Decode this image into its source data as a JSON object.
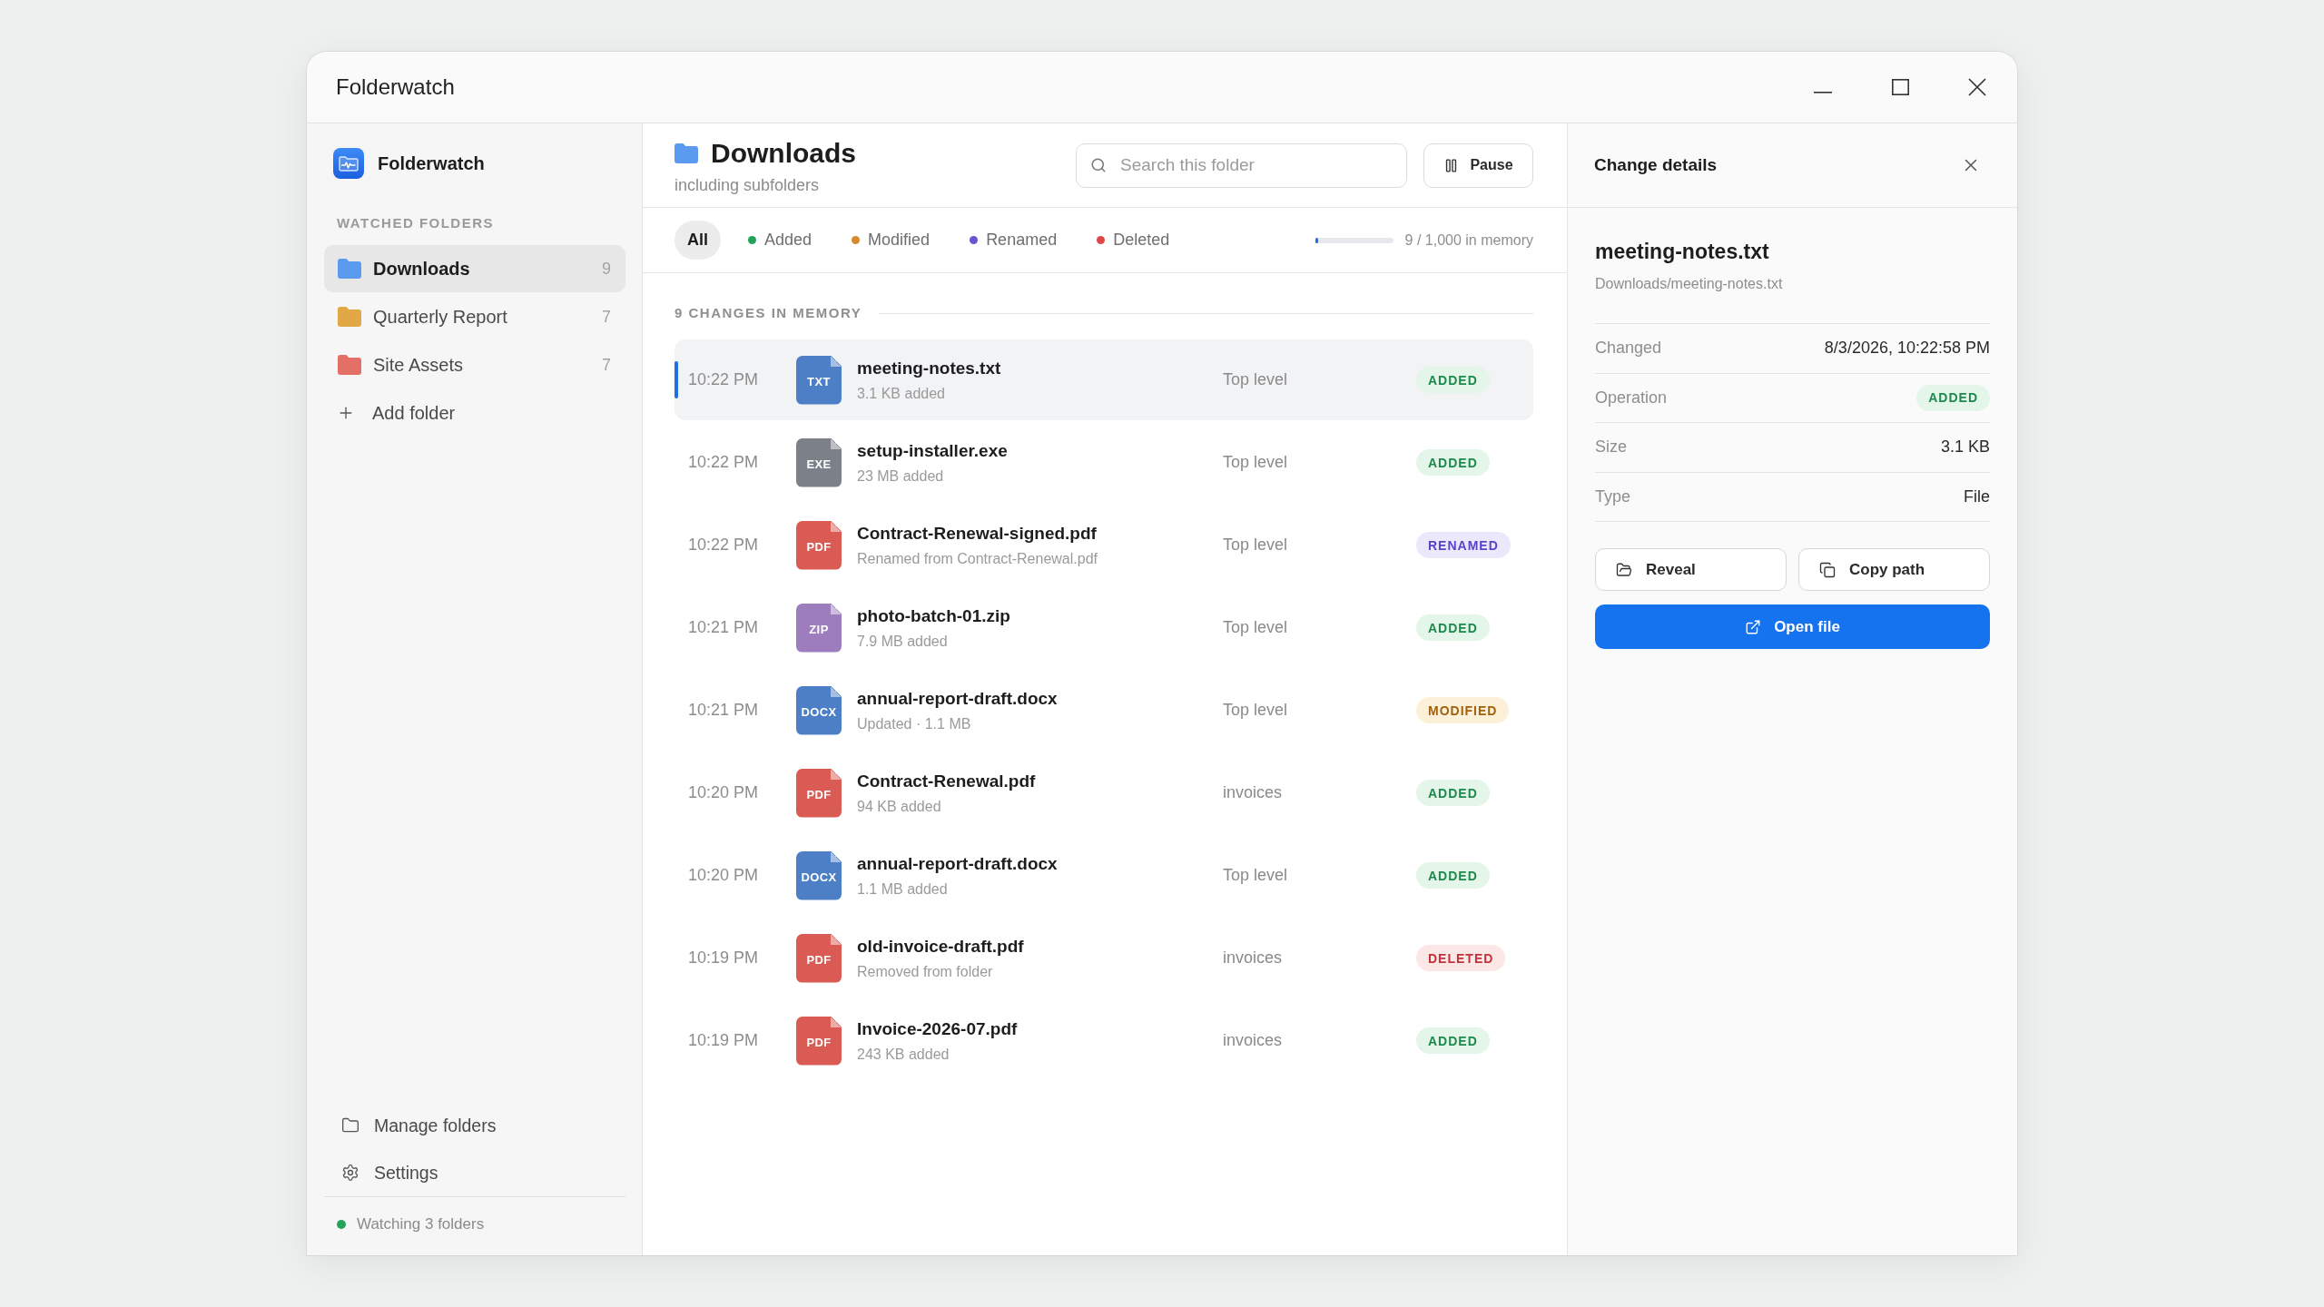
{
  "window": {
    "title": "Folderwatch"
  },
  "sidebar": {
    "brand": "Folderwatch",
    "heading": "WATCHED FOLDERS",
    "folders": [
      {
        "name": "Downloads",
        "count": "9",
        "color": "#5b9bef",
        "selected": true
      },
      {
        "name": "Quarterly Report",
        "count": "7",
        "color": "#e2a846",
        "selected": false
      },
      {
        "name": "Site Assets",
        "count": "7",
        "color": "#e46f66",
        "selected": false
      }
    ],
    "add_folder": "Add folder",
    "links": [
      "Manage folders",
      "Settings"
    ],
    "status": {
      "text": "Watching 3 folders",
      "color": "#22a35a"
    }
  },
  "header": {
    "title": "Downloads",
    "subtitle": "including subfolders",
    "search": {
      "placeholder": "Search this folder"
    },
    "pause_button": "Pause"
  },
  "filters": [
    {
      "label": "All",
      "selected": true
    },
    {
      "label": "Added",
      "color": "#22a35a",
      "selected": false
    },
    {
      "label": "Modified",
      "color": "#d8892c",
      "selected": false
    },
    {
      "label": "Renamed",
      "color": "#6a52d3",
      "selected": false
    },
    {
      "label": "Deleted",
      "color": "#e04848",
      "selected": false
    }
  ],
  "memory": {
    "level": 0.009,
    "label": "9 / 1,000 in memory"
  },
  "changes": {
    "heading": "9 CHANGES IN MEMORY",
    "rows": [
      {
        "time": "10:22 PM",
        "ext": "TXT",
        "color": "#4d7fc6",
        "name": "meeting-notes.txt",
        "detail": "3.1 KB added",
        "location": "Top level",
        "status": "ADDED",
        "kind": "added",
        "selected": true
      },
      {
        "time": "10:22 PM",
        "ext": "EXE",
        "color": "#7b8089",
        "name": "setup-installer.exe",
        "detail": "23 MB added",
        "location": "Top level",
        "status": "ADDED",
        "kind": "added",
        "selected": false
      },
      {
        "time": "10:22 PM",
        "ext": "PDF",
        "color": "#d95b53",
        "name": "Contract-Renewal-signed.pdf",
        "detail": "Renamed from Contract-Renewal.pdf",
        "location": "Top level",
        "status": "RENAMED",
        "kind": "renamed",
        "selected": false
      },
      {
        "time": "10:21 PM",
        "ext": "ZIP",
        "color": "#9d7dbd",
        "name": "photo-batch-01.zip",
        "detail": "7.9 MB added",
        "location": "Top level",
        "status": "ADDED",
        "kind": "added",
        "selected": false
      },
      {
        "time": "10:21 PM",
        "ext": "DOCX",
        "color": "#4d7fc6",
        "name": "annual-report-draft.docx",
        "detail": "Updated · 1.1 MB",
        "location": "Top level",
        "status": "MODIFIED",
        "kind": "modified",
        "selected": false
      },
      {
        "time": "10:20 PM",
        "ext": "PDF",
        "color": "#d95b53",
        "name": "Contract-Renewal.pdf",
        "detail": "94 KB added",
        "location": "invoices",
        "status": "ADDED",
        "kind": "added",
        "selected": false
      },
      {
        "time": "10:20 PM",
        "ext": "DOCX",
        "color": "#4d7fc6",
        "name": "annual-report-draft.docx",
        "detail": "1.1 MB added",
        "location": "Top level",
        "status": "ADDED",
        "kind": "added",
        "selected": false
      },
      {
        "time": "10:19 PM",
        "ext": "PDF",
        "color": "#d95b53",
        "name": "old-invoice-draft.pdf",
        "detail": "Removed from folder",
        "location": "invoices",
        "status": "DELETED",
        "kind": "deleted",
        "selected": false
      },
      {
        "time": "10:19 PM",
        "ext": "PDF",
        "color": "#d95b53",
        "name": "Invoice-2026-07.pdf",
        "detail": "243 KB added",
        "location": "invoices",
        "status": "ADDED",
        "kind": "added",
        "selected": false
      }
    ]
  },
  "details": {
    "title": "Change details",
    "file_name": "meeting-notes.txt",
    "path": "Downloads/meeting-notes.txt",
    "fields": [
      {
        "label": "Changed",
        "kind": "text",
        "value": "8/3/2026, 10:22:58 PM"
      },
      {
        "label": "Operation",
        "kind": "badge",
        "badge": {
          "text": "ADDED",
          "kind": "added"
        }
      },
      {
        "label": "Size",
        "kind": "text",
        "value": "3.1 KB"
      },
      {
        "label": "Type",
        "kind": "text",
        "value": "File"
      }
    ],
    "actions": [
      {
        "label": "Reveal",
        "kind": "secondary"
      },
      {
        "label": "Copy path",
        "kind": "secondary"
      },
      {
        "label": "Open file",
        "kind": "primary"
      }
    ]
  }
}
